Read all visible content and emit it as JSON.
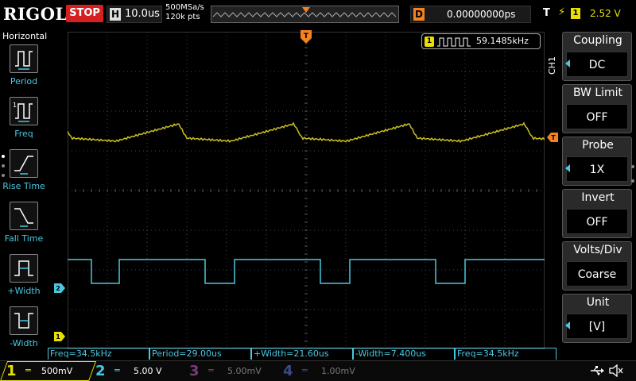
{
  "brand": "RIGOL",
  "run_state": "STOP",
  "horizontal": {
    "tag": "H",
    "timebase": "10.0us",
    "sample_rate": "500MSa/s",
    "memory_depth": "120k pts"
  },
  "delay": {
    "tag": "D",
    "value": "0.00000000ps"
  },
  "trigger": {
    "tag": "T",
    "source": "1",
    "level": "2.52 V"
  },
  "freq_counter": {
    "channel": "1",
    "value": "59.1485kHz"
  },
  "left_menu": {
    "title": "Horizontal",
    "items": [
      {
        "label": "Period",
        "icon": "period-icon"
      },
      {
        "label": "Freq",
        "icon": "freq-icon"
      },
      {
        "label": "Rise Time",
        "icon": "rise-time-icon"
      },
      {
        "label": "Fall Time",
        "icon": "fall-time-icon"
      },
      {
        "label": "+Width",
        "icon": "positive-width-icon"
      },
      {
        "label": "-Width",
        "icon": "negative-width-icon"
      }
    ]
  },
  "right_menu": {
    "channel": "CH1",
    "items": [
      {
        "title": "Coupling",
        "value": "DC"
      },
      {
        "title": "BW Limit",
        "value": "OFF"
      },
      {
        "title": "Probe",
        "value": "1X"
      },
      {
        "title": "Invert",
        "value": "OFF"
      },
      {
        "title": "Volts/Div",
        "value": "Coarse"
      },
      {
        "title": "Unit",
        "value": "[V]"
      }
    ]
  },
  "measurements": [
    "Freq=34.5kHz",
    "Period=29.00us",
    "+Width=21.60us",
    "-Width=7.400us",
    "Freq=34.5kHz"
  ],
  "channels": [
    {
      "number": "1",
      "scale": "500mV",
      "color": "#e8e000"
    },
    {
      "number": "2",
      "scale": "5.00 V",
      "color": "#48c8e0"
    },
    {
      "number": "3",
      "scale": "5.00mV",
      "color": "#c040c0"
    },
    {
      "number": "4",
      "scale": "1.00mV",
      "color": "#4060e0"
    }
  ],
  "markers": {
    "ch1": "1",
    "ch2": "2",
    "trigger": "T"
  },
  "colors": {
    "ch1": "#e8e000",
    "ch2": "#48c8e0",
    "accent": "#48c8e0",
    "trigger": "#f58220",
    "stop": "#d42020"
  }
}
